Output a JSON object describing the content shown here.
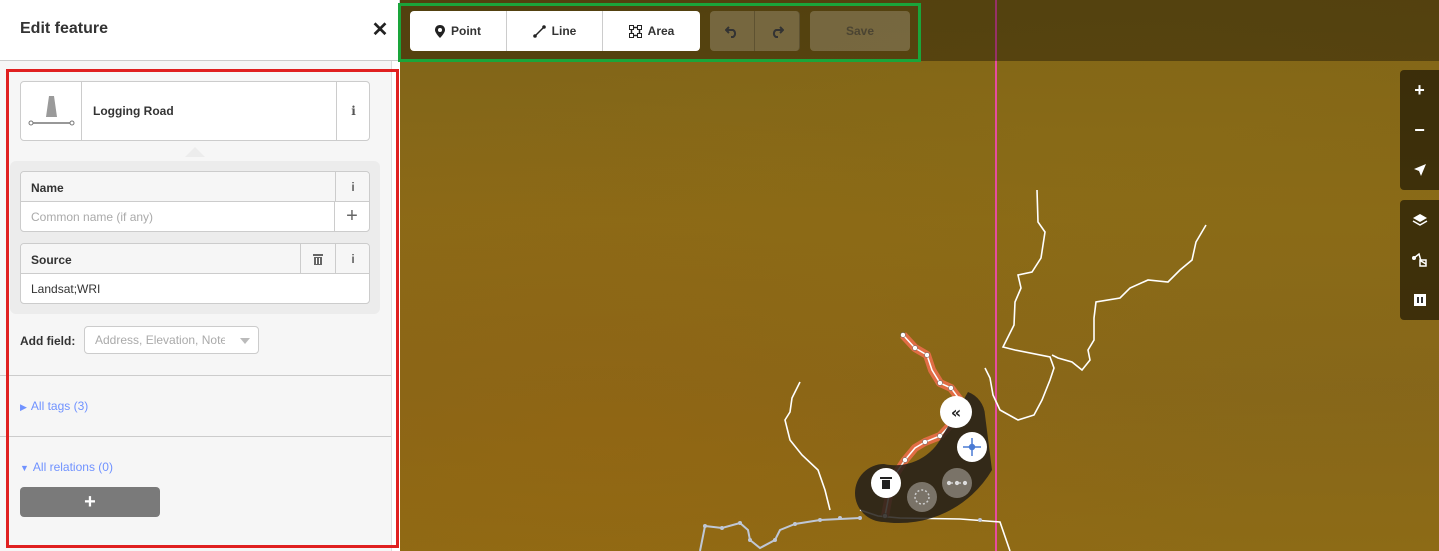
{
  "sidebar": {
    "title": "Edit feature",
    "close_glyph": "✕",
    "preset": {
      "name": "Logging Road",
      "icon": "road-icon",
      "info_glyph": "i"
    },
    "fields": [
      {
        "label": "Name",
        "placeholder": "Common name (if any)",
        "value": "",
        "info_glyph": "i",
        "add_glyph": "+"
      },
      {
        "label": "Source",
        "value": "Landsat;WRI",
        "info_glyph": "i",
        "delete_icon": "trash-icon"
      }
    ],
    "add_field": {
      "label": "Add field:",
      "placeholder": "Address, Elevation, Note..."
    },
    "all_tags": {
      "label": "All tags (3)",
      "expanded": false
    },
    "all_relations": {
      "label": "All relations (0)",
      "expanded": true,
      "add_glyph": "+"
    }
  },
  "toolbar": {
    "modes": [
      {
        "label": "Point",
        "icon": "point-marker-icon"
      },
      {
        "label": "Line",
        "icon": "line-icon"
      },
      {
        "label": "Area",
        "icon": "area-icon"
      }
    ],
    "undo_icon": "undo-icon",
    "redo_icon": "redo-icon",
    "save_label": "Save"
  },
  "map_controls": {
    "zoom_in": "+",
    "zoom_out": "−",
    "geolocate_icon": "navigation-arrow-icon",
    "background_icon": "layers-icon",
    "map_data_icon": "map-data-icon",
    "issues_icon": "help-panel-icon"
  },
  "edit_menu": {
    "items": [
      "straighten-icon",
      "move-icon",
      "delete-icon",
      "circularize-icon",
      "disconnect-icon"
    ]
  },
  "colors": {
    "accent_link": "#7092ff",
    "selected_way": "#f06e4e",
    "highlight_red": "#e02020",
    "highlight_green": "#1aa53a",
    "boundary_line": "#e64ca0"
  }
}
